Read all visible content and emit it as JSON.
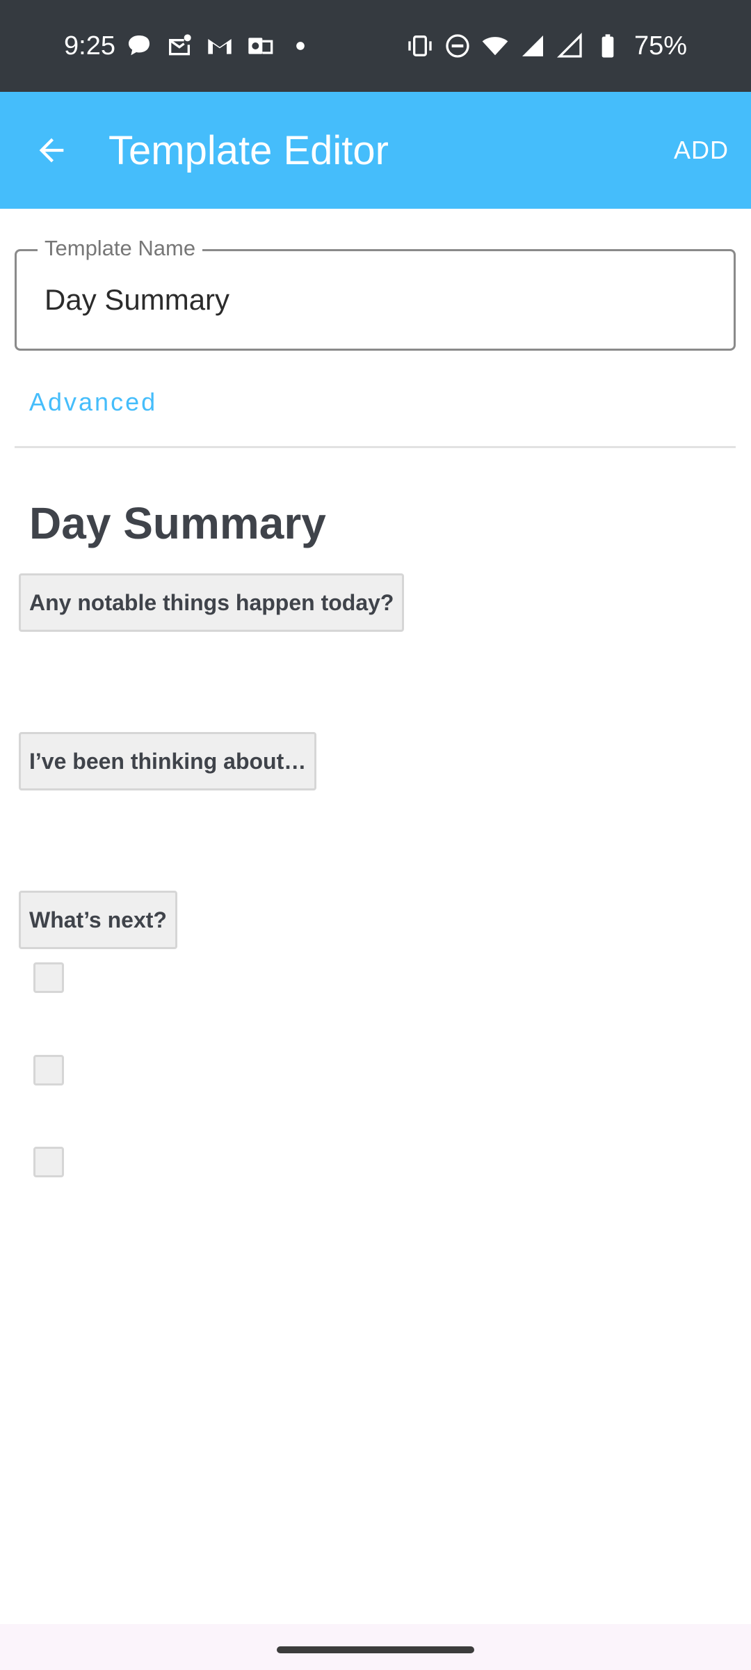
{
  "status_bar": {
    "time": "9:25",
    "battery_percent": "75%",
    "left_icons": [
      "chat-bubble-icon",
      "mail-notification-icon",
      "gmail-icon",
      "outlook-icon",
      "more-dot-icon"
    ],
    "right_icons": [
      "vibrate-icon",
      "do-not-disturb-icon",
      "wifi-icon",
      "signal-icon",
      "signal-icon",
      "battery-icon"
    ]
  },
  "app_bar": {
    "title": "Template Editor",
    "action_label": "ADD",
    "background": "#45bdfb"
  },
  "template_name_field": {
    "label": "Template Name",
    "value": "Day Summary"
  },
  "advanced_label": "Advanced",
  "document": {
    "title": "Day Summary",
    "prompts": [
      "Any notable things happen today?",
      "I’ve been thinking about…",
      "What’s next?"
    ],
    "checkboxes": [
      {
        "checked": false
      },
      {
        "checked": false
      },
      {
        "checked": false
      }
    ]
  },
  "colors": {
    "status_bar": "#353a40",
    "accent": "#45bdfb",
    "chip_background": "#efefef",
    "text_dark": "#3f434a"
  }
}
